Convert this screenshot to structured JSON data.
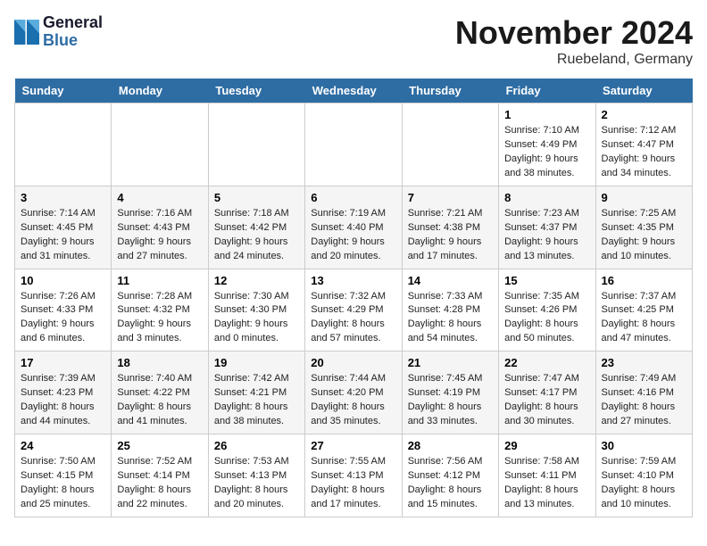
{
  "logo": {
    "line1": "General",
    "line2": "Blue"
  },
  "title": "November 2024",
  "location": "Ruebeland, Germany",
  "days_of_week": [
    "Sunday",
    "Monday",
    "Tuesday",
    "Wednesday",
    "Thursday",
    "Friday",
    "Saturday"
  ],
  "weeks": [
    [
      {
        "day": "",
        "info": ""
      },
      {
        "day": "",
        "info": ""
      },
      {
        "day": "",
        "info": ""
      },
      {
        "day": "",
        "info": ""
      },
      {
        "day": "",
        "info": ""
      },
      {
        "day": "1",
        "info": "Sunrise: 7:10 AM\nSunset: 4:49 PM\nDaylight: 9 hours and 38 minutes."
      },
      {
        "day": "2",
        "info": "Sunrise: 7:12 AM\nSunset: 4:47 PM\nDaylight: 9 hours and 34 minutes."
      }
    ],
    [
      {
        "day": "3",
        "info": "Sunrise: 7:14 AM\nSunset: 4:45 PM\nDaylight: 9 hours and 31 minutes."
      },
      {
        "day": "4",
        "info": "Sunrise: 7:16 AM\nSunset: 4:43 PM\nDaylight: 9 hours and 27 minutes."
      },
      {
        "day": "5",
        "info": "Sunrise: 7:18 AM\nSunset: 4:42 PM\nDaylight: 9 hours and 24 minutes."
      },
      {
        "day": "6",
        "info": "Sunrise: 7:19 AM\nSunset: 4:40 PM\nDaylight: 9 hours and 20 minutes."
      },
      {
        "day": "7",
        "info": "Sunrise: 7:21 AM\nSunset: 4:38 PM\nDaylight: 9 hours and 17 minutes."
      },
      {
        "day": "8",
        "info": "Sunrise: 7:23 AM\nSunset: 4:37 PM\nDaylight: 9 hours and 13 minutes."
      },
      {
        "day": "9",
        "info": "Sunrise: 7:25 AM\nSunset: 4:35 PM\nDaylight: 9 hours and 10 minutes."
      }
    ],
    [
      {
        "day": "10",
        "info": "Sunrise: 7:26 AM\nSunset: 4:33 PM\nDaylight: 9 hours and 6 minutes."
      },
      {
        "day": "11",
        "info": "Sunrise: 7:28 AM\nSunset: 4:32 PM\nDaylight: 9 hours and 3 minutes."
      },
      {
        "day": "12",
        "info": "Sunrise: 7:30 AM\nSunset: 4:30 PM\nDaylight: 9 hours and 0 minutes."
      },
      {
        "day": "13",
        "info": "Sunrise: 7:32 AM\nSunset: 4:29 PM\nDaylight: 8 hours and 57 minutes."
      },
      {
        "day": "14",
        "info": "Sunrise: 7:33 AM\nSunset: 4:28 PM\nDaylight: 8 hours and 54 minutes."
      },
      {
        "day": "15",
        "info": "Sunrise: 7:35 AM\nSunset: 4:26 PM\nDaylight: 8 hours and 50 minutes."
      },
      {
        "day": "16",
        "info": "Sunrise: 7:37 AM\nSunset: 4:25 PM\nDaylight: 8 hours and 47 minutes."
      }
    ],
    [
      {
        "day": "17",
        "info": "Sunrise: 7:39 AM\nSunset: 4:23 PM\nDaylight: 8 hours and 44 minutes."
      },
      {
        "day": "18",
        "info": "Sunrise: 7:40 AM\nSunset: 4:22 PM\nDaylight: 8 hours and 41 minutes."
      },
      {
        "day": "19",
        "info": "Sunrise: 7:42 AM\nSunset: 4:21 PM\nDaylight: 8 hours and 38 minutes."
      },
      {
        "day": "20",
        "info": "Sunrise: 7:44 AM\nSunset: 4:20 PM\nDaylight: 8 hours and 35 minutes."
      },
      {
        "day": "21",
        "info": "Sunrise: 7:45 AM\nSunset: 4:19 PM\nDaylight: 8 hours and 33 minutes."
      },
      {
        "day": "22",
        "info": "Sunrise: 7:47 AM\nSunset: 4:17 PM\nDaylight: 8 hours and 30 minutes."
      },
      {
        "day": "23",
        "info": "Sunrise: 7:49 AM\nSunset: 4:16 PM\nDaylight: 8 hours and 27 minutes."
      }
    ],
    [
      {
        "day": "24",
        "info": "Sunrise: 7:50 AM\nSunset: 4:15 PM\nDaylight: 8 hours and 25 minutes."
      },
      {
        "day": "25",
        "info": "Sunrise: 7:52 AM\nSunset: 4:14 PM\nDaylight: 8 hours and 22 minutes."
      },
      {
        "day": "26",
        "info": "Sunrise: 7:53 AM\nSunset: 4:13 PM\nDaylight: 8 hours and 20 minutes."
      },
      {
        "day": "27",
        "info": "Sunrise: 7:55 AM\nSunset: 4:13 PM\nDaylight: 8 hours and 17 minutes."
      },
      {
        "day": "28",
        "info": "Sunrise: 7:56 AM\nSunset: 4:12 PM\nDaylight: 8 hours and 15 minutes."
      },
      {
        "day": "29",
        "info": "Sunrise: 7:58 AM\nSunset: 4:11 PM\nDaylight: 8 hours and 13 minutes."
      },
      {
        "day": "30",
        "info": "Sunrise: 7:59 AM\nSunset: 4:10 PM\nDaylight: 8 hours and 10 minutes."
      }
    ]
  ]
}
